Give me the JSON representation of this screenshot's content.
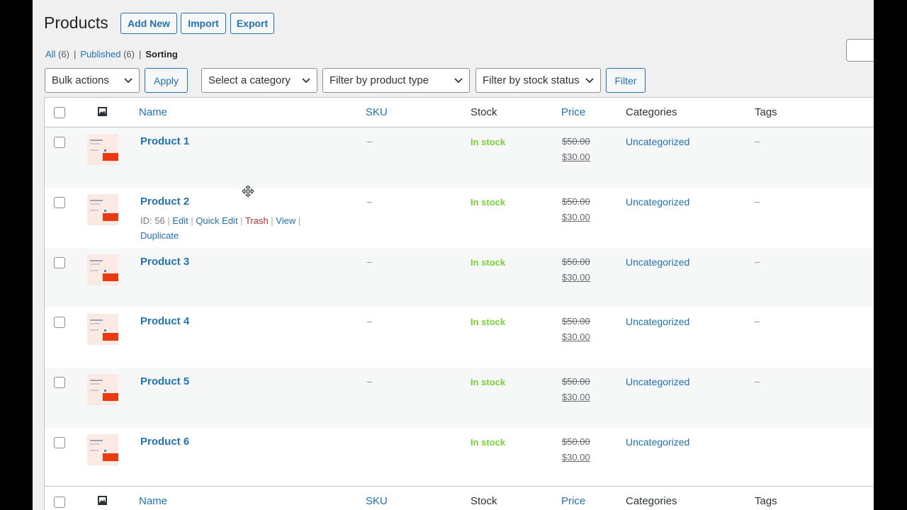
{
  "page": {
    "title": "Products",
    "buttons": [
      "Add New",
      "Import",
      "Export"
    ]
  },
  "views": {
    "all_label": "All",
    "all_count": "(6)",
    "published_label": "Published",
    "published_count": "(6)",
    "current": "Sorting"
  },
  "filters": {
    "bulk_actions": "Bulk actions",
    "apply": "Apply",
    "category": "Select a category",
    "product_type": "Filter by product type",
    "stock_status": "Filter by stock status",
    "filter": "Filter"
  },
  "columns": {
    "name": "Name",
    "sku": "SKU",
    "stock": "Stock",
    "price": "Price",
    "categories": "Categories",
    "tags": "Tags"
  },
  "row_actions": {
    "id": "ID: 56",
    "edit": "Edit",
    "quick_edit": "Quick Edit",
    "trash": "Trash",
    "view": "View",
    "duplicate": "Duplicate"
  },
  "products": [
    {
      "name": "Product 1",
      "sku": "–",
      "stock": "In stock",
      "regular_price": "$50.00",
      "sale_price": "$30.00",
      "category": "Uncategorized",
      "tags": "–"
    },
    {
      "name": "Product 2",
      "sku": "–",
      "stock": "In stock",
      "regular_price": "$50.00",
      "sale_price": "$30.00",
      "category": "Uncategorized",
      "tags": "–"
    },
    {
      "name": "Product 3",
      "sku": "–",
      "stock": "In stock",
      "regular_price": "$50.00",
      "sale_price": "$30.00",
      "category": "Uncategorized",
      "tags": "–"
    },
    {
      "name": "Product 4",
      "sku": "–",
      "stock": "In stock",
      "regular_price": "$50.00",
      "sale_price": "$30.00",
      "category": "Uncategorized",
      "tags": "–"
    },
    {
      "name": "Product 5",
      "sku": "–",
      "stock": "In stock",
      "regular_price": "$50.00",
      "sale_price": "$30.00",
      "category": "Uncategorized",
      "tags": "–"
    },
    {
      "name": "Product 6",
      "sku": "",
      "stock": "In stock",
      "regular_price": "$50.00",
      "sale_price": "$30.00",
      "category": "Uncategorized",
      "tags": ""
    }
  ],
  "colors": {
    "link": "#2271b1",
    "in_stock": "#7ad03a",
    "trash": "#b32d2e"
  },
  "icons": [
    "image-icon",
    "chevron-down-icon",
    "move-cursor-icon"
  ]
}
